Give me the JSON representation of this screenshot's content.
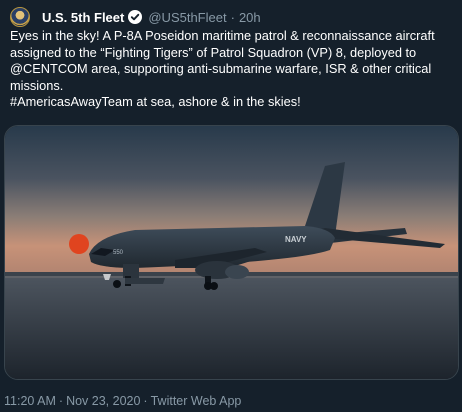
{
  "tweet": {
    "display_name": "U.S. 5th Fleet",
    "handle": "@US5thFleet",
    "separator": "·",
    "age": "20h",
    "text_part1": "Eyes in the sky!  A P-8A Poseidon maritime patrol & reconnaissance aircraft assigned to the “Fighting Tigers” of Patrol Squadron (VP) 8, deployed to ",
    "mention": "@CENTCOM",
    "text_part2": " area, supporting anti-submarine warfare, ISR & other critical missions.",
    "hashtag": "#AmericasAwayTeam",
    "text_part3": " at sea, ashore & in the skies!",
    "aircraft_markings": {
      "tail_number": "550",
      "fuselage": "NAVY"
    },
    "time": "11:20 AM",
    "date": "Nov 23, 2020",
    "meta_separator": "·",
    "source": "Twitter Web App"
  },
  "colors": {
    "background": "#15202b",
    "secondary_text": "#8899a6",
    "border": "#38444d"
  },
  "icons": {
    "avatar": "fleet-seal-avatar",
    "verified": "verified-badge-icon"
  }
}
